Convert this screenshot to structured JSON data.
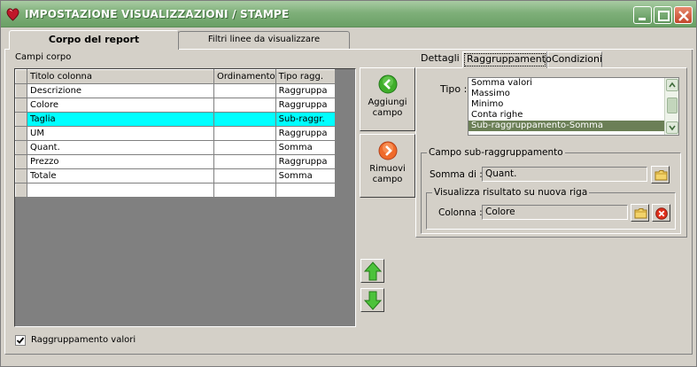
{
  "window": {
    "title": "IMPOSTAZIONE VISUALIZZAZIONI / STAMPE",
    "accent": "#7fb07a"
  },
  "tabs": [
    {
      "label": "Corpo del report",
      "active": true
    },
    {
      "label": "Filtri linee da visualizzare",
      "active": false
    }
  ],
  "left": {
    "section_label": "Campi corpo",
    "columns": [
      "Titolo colonna",
      "Ordinamento",
      "Tipo ragg."
    ],
    "rows": [
      {
        "titolo": "Descrizione",
        "ordinamento": "",
        "tipo": "Raggruppa"
      },
      {
        "titolo": "Colore",
        "ordinamento": "",
        "tipo": "Raggruppa"
      },
      {
        "titolo": "Taglia",
        "ordinamento": "",
        "tipo": "Sub-raggr."
      },
      {
        "titolo": "UM",
        "ordinamento": "",
        "tipo": "Raggruppa"
      },
      {
        "titolo": "Quant.",
        "ordinamento": "",
        "tipo": "Somma"
      },
      {
        "titolo": "Prezzo",
        "ordinamento": "",
        "tipo": "Raggruppa"
      },
      {
        "titolo": "Totale",
        "ordinamento": "",
        "tipo": "Somma"
      },
      {
        "titolo": "",
        "ordinamento": "",
        "tipo": ""
      }
    ],
    "selected_row_color": "#00ffff",
    "checkbox_label": "Raggruppamento valori",
    "checkbox_checked": true
  },
  "middle": {
    "add_label_1": "Aggiungi",
    "add_label_2": "campo",
    "remove_label_1": "Rimuovi",
    "remove_label_2": "campo",
    "add_icon": "arrow-left-green-icon",
    "remove_icon": "arrow-right-orange-icon",
    "up_icon": "arrow-up-green-icon",
    "down_icon": "arrow-down-green-icon"
  },
  "right": {
    "subtabs": [
      "Dettagli",
      "Raggruppamento",
      "Condizioni"
    ],
    "active_subtab": "Raggruppamento",
    "tipo_label": "Tipo :",
    "tipo_options": [
      "Somma valori",
      "Massimo",
      "Minimo",
      "Conta righe",
      "Sub-raggruppamento-Somma"
    ],
    "tipo_selected": "Sub-raggruppamento-Somma",
    "group_sub_title": "Campo sub-raggruppamento",
    "somma_label": "Somma di :",
    "somma_value": "Quant.",
    "group_visual_title": "Visualizza risultato su nuova riga",
    "colonna_label": "Colonna :",
    "colonna_value": "Colore"
  }
}
